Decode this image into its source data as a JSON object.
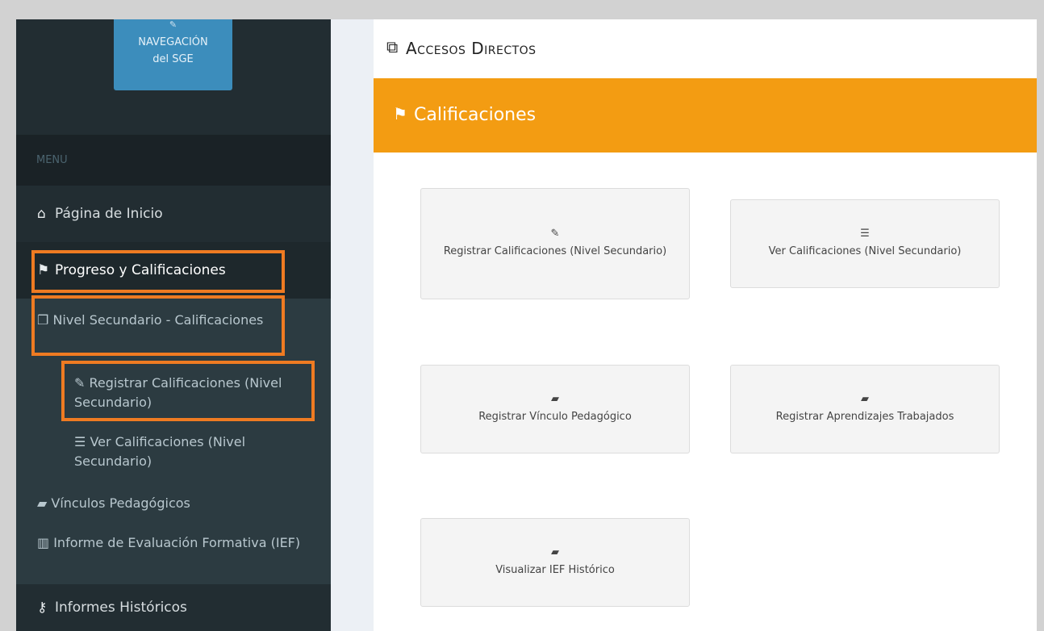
{
  "sidebar": {
    "nav_button": {
      "icon": "edit-icon",
      "line1": "NAVEGACIÓN",
      "line2": "del SGE"
    },
    "menu_header": "MENU",
    "items": {
      "home": {
        "icon": "home-icon",
        "label": "Página de Inicio"
      },
      "progress": {
        "icon": "flag-checkered-icon",
        "label": "Progreso y Calificaciones"
      },
      "nivel": {
        "icon": "copy-icon",
        "label": "Nivel Secundario - Calificaciones"
      },
      "registrar": {
        "icon": "edit-icon",
        "label": "Registrar Calificaciones (Nivel Secundario)"
      },
      "ver": {
        "icon": "list-ol-icon",
        "label": "Ver Calificaciones (Nivel Secundario)"
      },
      "vinculos": {
        "icon": "book-icon",
        "label": "Vínculos Pedagógicos"
      },
      "informe": {
        "icon": "map-icon",
        "label": "Informe de Evaluación Formativa (IEF)"
      },
      "historicos": {
        "icon": "key-icon",
        "label": "Informes Históricos"
      }
    }
  },
  "main": {
    "header": {
      "icon": "external-link-icon",
      "title": "Accesos Directos"
    },
    "box": {
      "icon": "flag-checkered-icon",
      "title": "Calificaciones",
      "tiles": [
        {
          "icon": "edit-icon",
          "label": "Registrar Calificaciones (Nivel Secundario)"
        },
        {
          "icon": "list-ol-icon",
          "label": "Ver Calificaciones (Nivel Secundario)"
        },
        {
          "icon": "book-icon",
          "label": "Registrar Vínculo Pedagógico"
        },
        {
          "icon": "book-icon",
          "label": "Registrar Aprendizajes Trabajados"
        },
        {
          "icon": "book-icon",
          "label": "Visualizar IEF Histórico"
        }
      ]
    }
  },
  "colors": {
    "sidebar_bg": "#222d32",
    "submenu_bg": "#2c3b41",
    "nav_button_bg": "#3c8dbc",
    "box_header_bg": "#f39c12",
    "highlight_border": "#ef7b22"
  }
}
